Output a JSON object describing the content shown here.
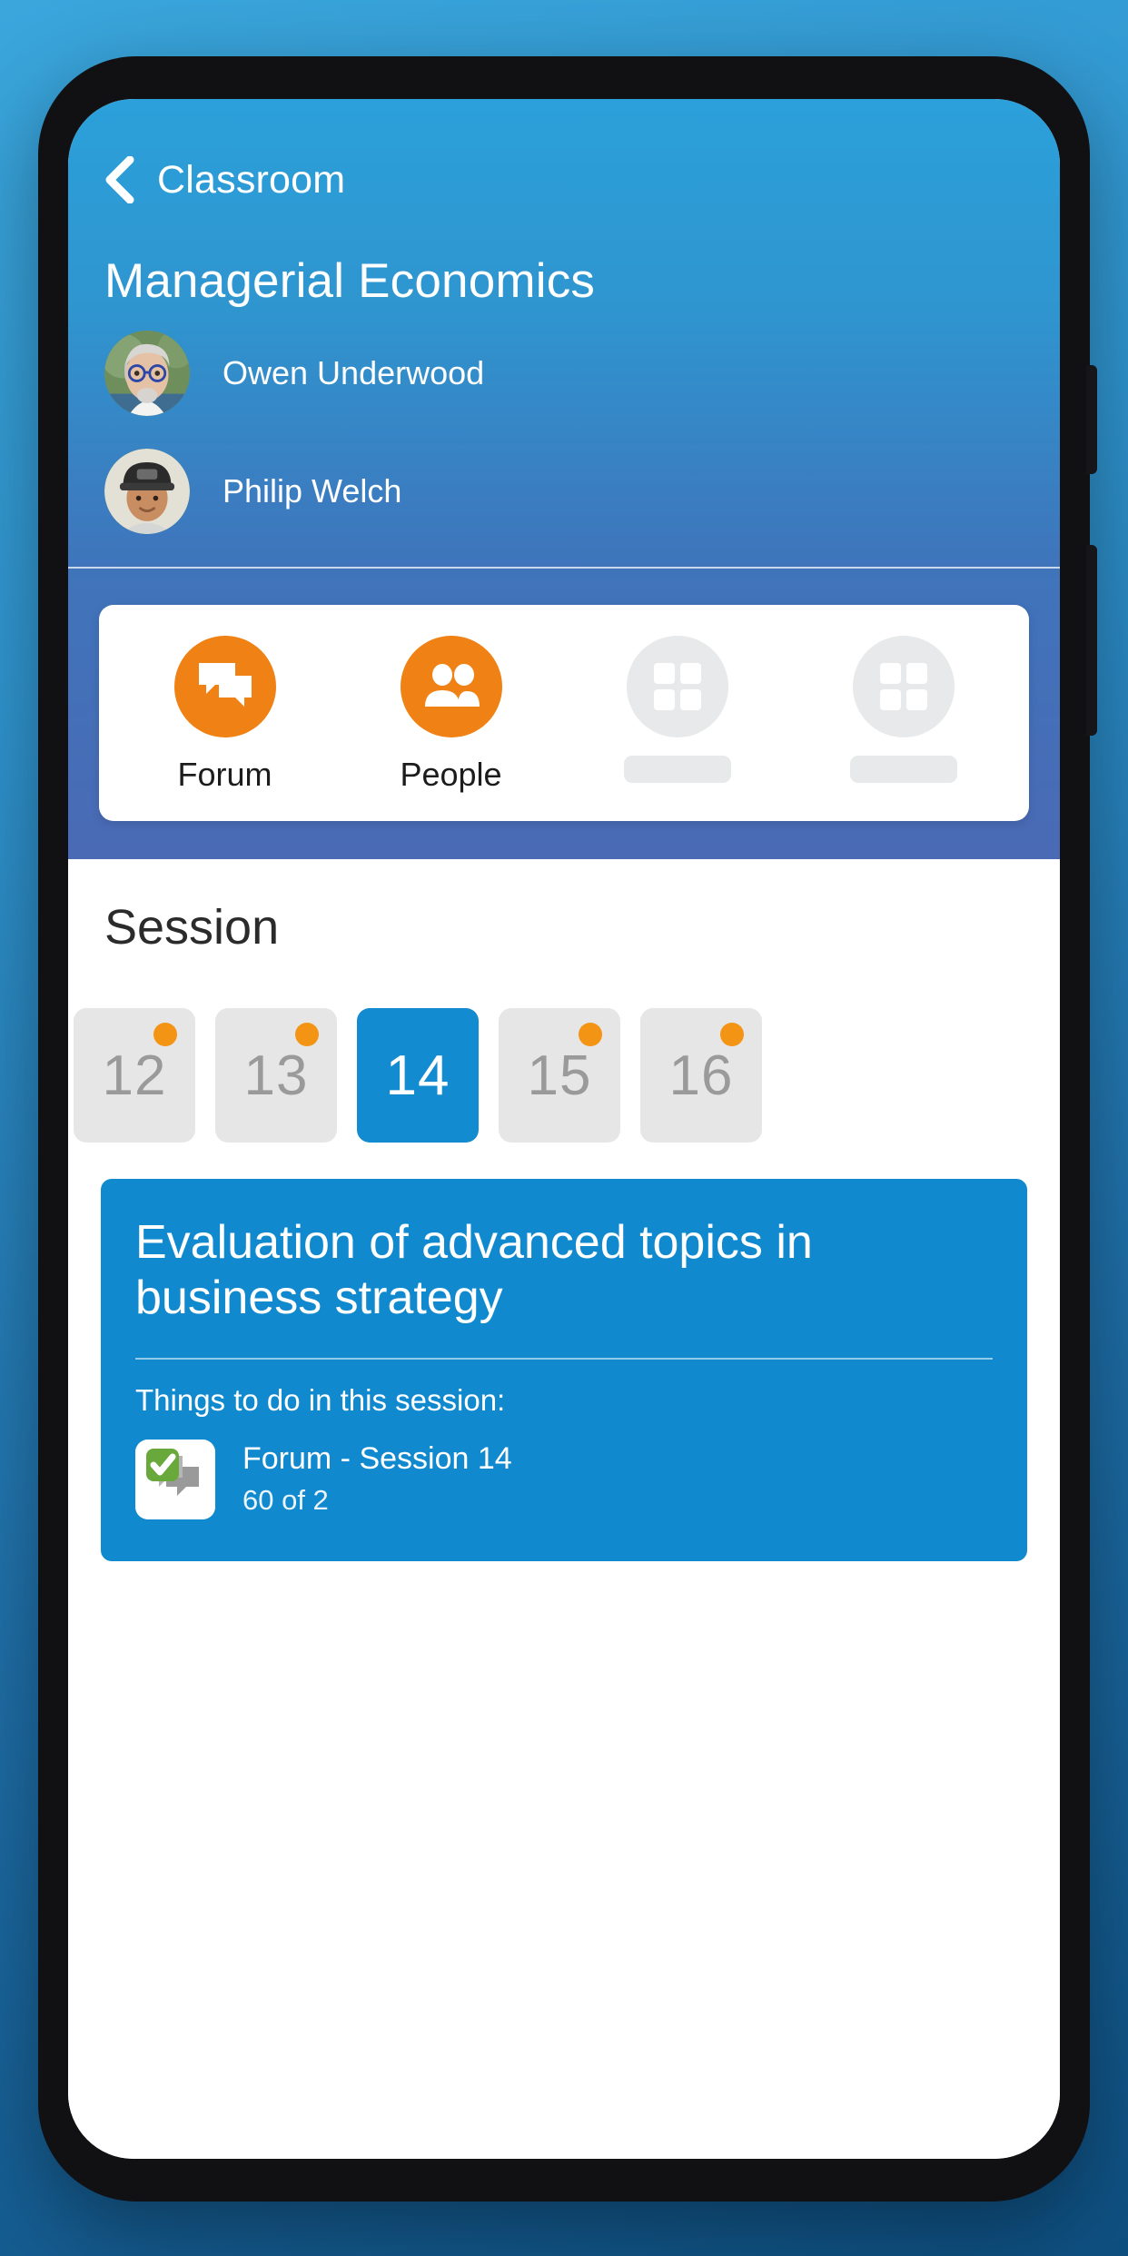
{
  "theme": {
    "accent_blue": "#1089cf",
    "accent_orange": "#ef8115",
    "badge_orange": "#f39415",
    "selected_day_blue": "#128bd1",
    "check_green": "#69a83a",
    "tile_grey": "#e6e6e6",
    "skeleton_grey": "#e8e9ea"
  },
  "nav": {
    "back_label": "Classroom",
    "back_icon": "chevron-left-icon"
  },
  "course": {
    "title": "Managerial Economics",
    "teachers": [
      {
        "name": "Owen Underwood",
        "avatar": "avatar-owen-underwood"
      },
      {
        "name": "Philip Welch",
        "avatar": "avatar-philip-welch"
      }
    ]
  },
  "tabs": [
    {
      "label": "Forum",
      "icon": "forum-icon",
      "state": "active"
    },
    {
      "label": "People",
      "icon": "people-icon",
      "state": "active"
    },
    {
      "label": "",
      "icon": "grid-placeholder-icon",
      "state": "loading"
    },
    {
      "label": "",
      "icon": "grid-placeholder-icon",
      "state": "loading"
    }
  ],
  "session": {
    "heading": "Session",
    "days": [
      {
        "number": "12",
        "selected": false,
        "has_badge": true
      },
      {
        "number": "13",
        "selected": false,
        "has_badge": true
      },
      {
        "number": "14",
        "selected": true,
        "has_badge": false
      },
      {
        "number": "15",
        "selected": false,
        "has_badge": true
      },
      {
        "number": "16",
        "selected": false,
        "has_badge": true
      }
    ],
    "card": {
      "title": "Evaluation of advanced topics in business strategy",
      "todo_label": "Things to do in this session:",
      "items": [
        {
          "title": "Forum - Session 14",
          "subtitle": "60 of 2",
          "icon": "forum-activity-icon",
          "status_icon": "check-badge-icon"
        }
      ]
    }
  }
}
